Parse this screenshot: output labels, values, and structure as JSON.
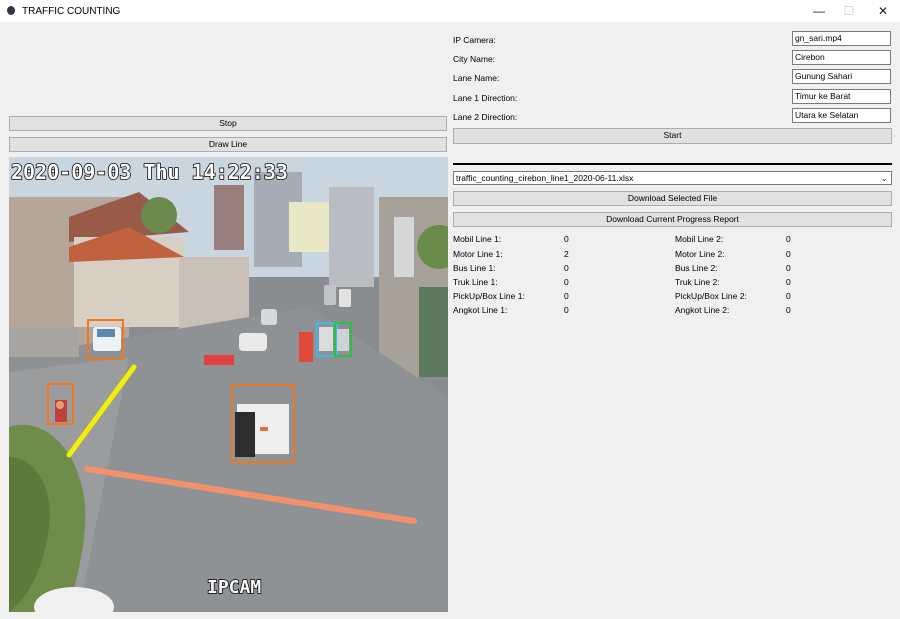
{
  "window": {
    "title": "TRAFFIC COUNTING",
    "minimize_glyph": "—",
    "maximize_glyph": "☐",
    "close_glyph": "✕"
  },
  "controls": {
    "stop_label": "Stop",
    "draw_line_label": "Draw Line",
    "start_label": "Start",
    "download_selected_label": "Download Selected File",
    "download_progress_label": "Download Current Progress Report"
  },
  "form": {
    "ip_camera": {
      "label": "IP Camera:",
      "value": "gn_sari.mp4"
    },
    "city_name": {
      "label": "City Name:",
      "value": "Cirebon"
    },
    "lane_name": {
      "label": "Lane Name:",
      "value": "Gunung Sahari"
    },
    "lane1_direction": {
      "label": "Lane 1 Direction:",
      "value": "Timur ke Barat"
    },
    "lane2_direction": {
      "label": "Lane 2 Direction:",
      "value": "Utara ke Selatan"
    }
  },
  "file_select": {
    "selected": "traffic_counting_cirebon_line1_2020-06-11.xlsx"
  },
  "stats": {
    "line1": [
      {
        "label": "Mobil Line 1:",
        "value": "0"
      },
      {
        "label": "Motor Line 1:",
        "value": "2"
      },
      {
        "label": "Bus Line 1:",
        "value": "0"
      },
      {
        "label": "Truk Line 1:",
        "value": "0"
      },
      {
        "label": "PickUp/Box Line 1:",
        "value": "0"
      },
      {
        "label": "Angkot Line 1:",
        "value": "0"
      }
    ],
    "line2": [
      {
        "label": "Mobil Line 2:",
        "value": "0"
      },
      {
        "label": "Motor Line 2:",
        "value": "0"
      },
      {
        "label": "Bus Line 2:",
        "value": "0"
      },
      {
        "label": "Truk Line 2:",
        "value": "0"
      },
      {
        "label": "PickUp/Box Line 2:",
        "value": "0"
      },
      {
        "label": "Angkot Line 2:",
        "value": "0"
      }
    ]
  },
  "video": {
    "timestamp": "2020-09-03 Thu 14:22:33",
    "watermark": "IPCAM",
    "colors": {
      "line1": "#f0f000",
      "line2": "#f4906a",
      "box_orange": "#f07820",
      "box_blue": "#40b8e8",
      "box_green": "#30c040"
    }
  }
}
